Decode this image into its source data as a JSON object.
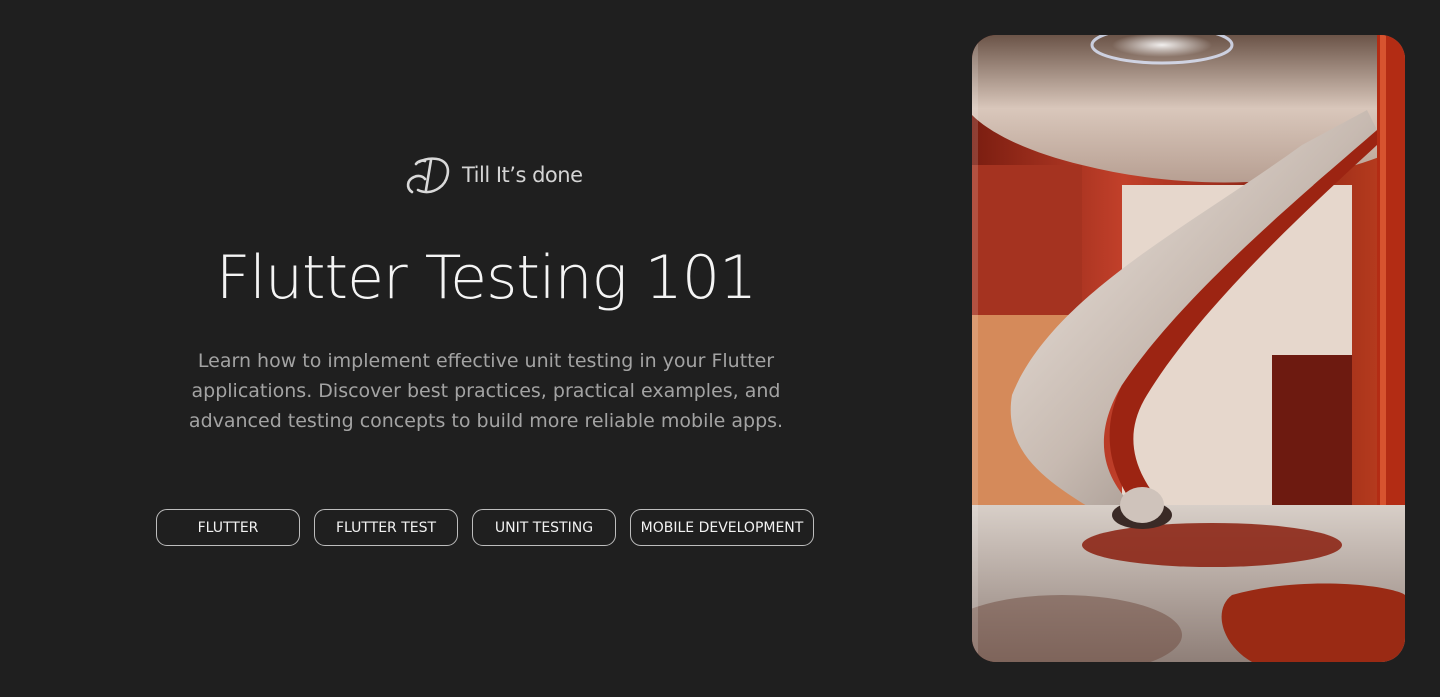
{
  "brand": {
    "logo_icon": "td-signature-logo-icon",
    "name": "Till It’s done"
  },
  "hero": {
    "title": "Flutter Testing 101",
    "description": "Learn how to implement effective unit testing in your Flutter applications. Discover best practices, practical examples, and advanced testing concepts to build more reliable mobile apps."
  },
  "tags": [
    "FLUTTER",
    "FLUTTER TEST",
    "UNIT TESTING",
    "MOBILE DEVELOPMENT"
  ],
  "cover_image": {
    "icon": "architecture-staircase-image"
  },
  "colors": {
    "background": "#1f1f1f",
    "text": "#f4f4f4",
    "muted": "#a3a3a3",
    "accent": "#b5301a"
  }
}
